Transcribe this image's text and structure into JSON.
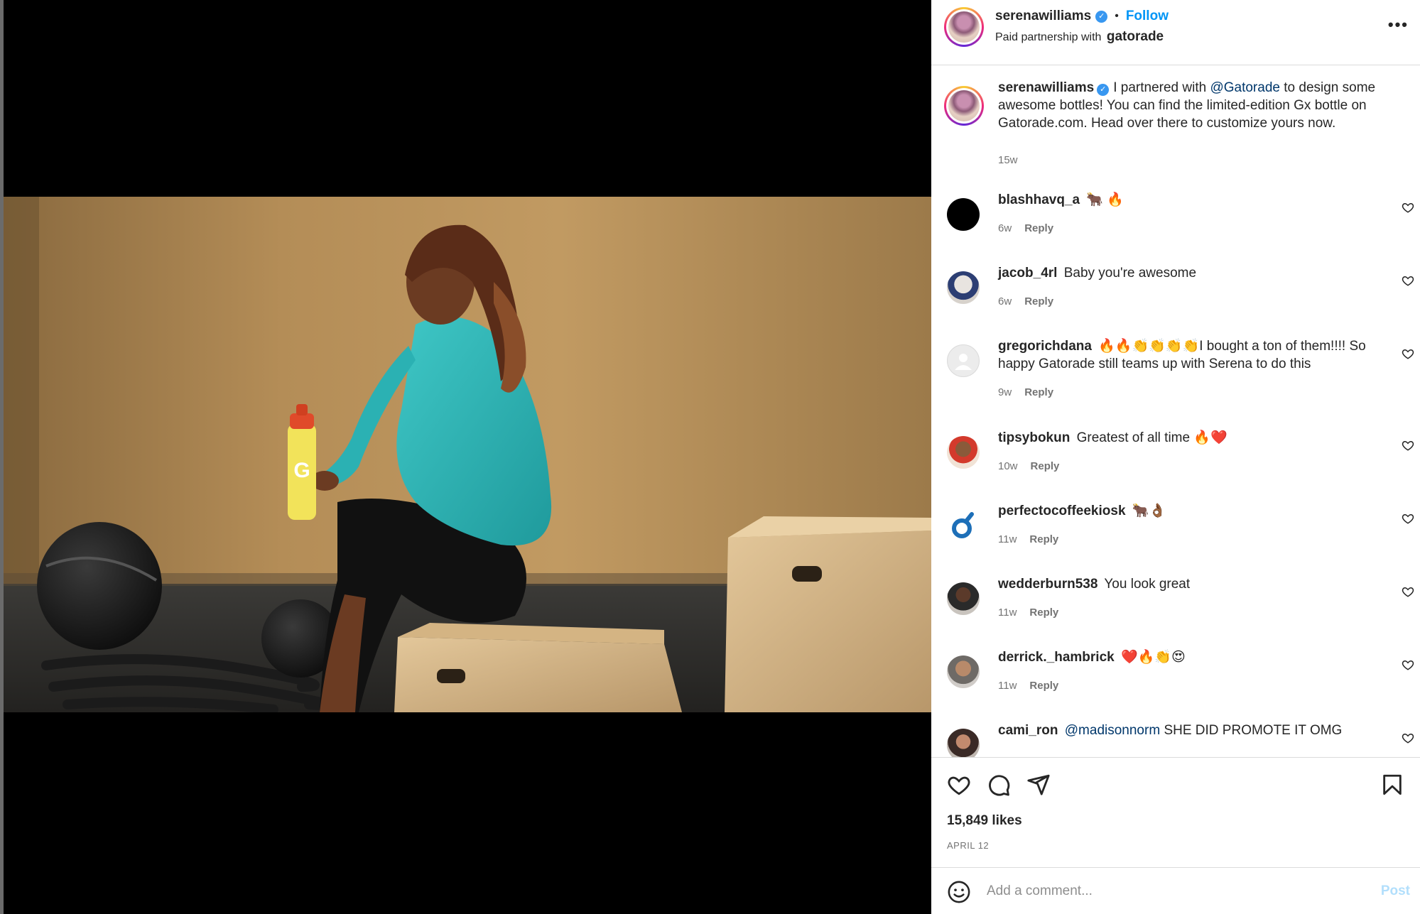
{
  "post": {
    "username": "serenawilliams",
    "verified_mark": "✓",
    "separator": "•",
    "follow_label": "Follow",
    "partnership_prefix": "Paid partnership with",
    "partner_name": "gatorade",
    "more_label": "•••"
  },
  "caption": {
    "username": "serenawilliams",
    "text_before": "I partnered with",
    "mention": "@Gatorade",
    "text_after": "to design some awesome bottles! You can find the limited-edition Gx bottle on Gatorade.com. Head over there to customize yours now.",
    "time": "15w"
  },
  "comments": [
    {
      "username": "blashhavq_a",
      "text": "🐂 🔥",
      "time": "6w",
      "reply_label": "Reply"
    },
    {
      "username": "jacob_4rl",
      "text": "Baby you're awesome",
      "time": "6w",
      "reply_label": "Reply"
    },
    {
      "username": "gregorichdana",
      "text": "🔥🔥👏👏👏👏I bought a ton of them!!!! So happy Gatorade still teams up with Serena to do this",
      "time": "9w",
      "reply_label": "Reply"
    },
    {
      "username": "tipsybokun",
      "text": "Greatest of all time 🔥❤️",
      "time": "10w",
      "reply_label": "Reply"
    },
    {
      "username": "perfectocoffeekiosk",
      "text": "🐂👌🏾",
      "time": "11w",
      "reply_label": "Reply"
    },
    {
      "username": "wedderburn538",
      "text": "You look great",
      "time": "11w",
      "reply_label": "Reply"
    },
    {
      "username": "derrick._hambrick",
      "text": "❤️🔥👏😍",
      "time": "11w",
      "reply_label": "Reply"
    },
    {
      "username": "cami_ron",
      "mention": "@madisonnorm",
      "text": "SHE DID PROMOTE IT OMG",
      "time": "",
      "reply_label": ""
    }
  ],
  "actions": {
    "likes": "15,849 likes",
    "date": "APRIL 12"
  },
  "composer": {
    "placeholder": "Add a comment...",
    "post_label": "Post"
  },
  "colors": {
    "accent": "#0095f6",
    "post_disabled": "#b2dffc",
    "verified": "#3897f0",
    "mention": "#00376b"
  }
}
